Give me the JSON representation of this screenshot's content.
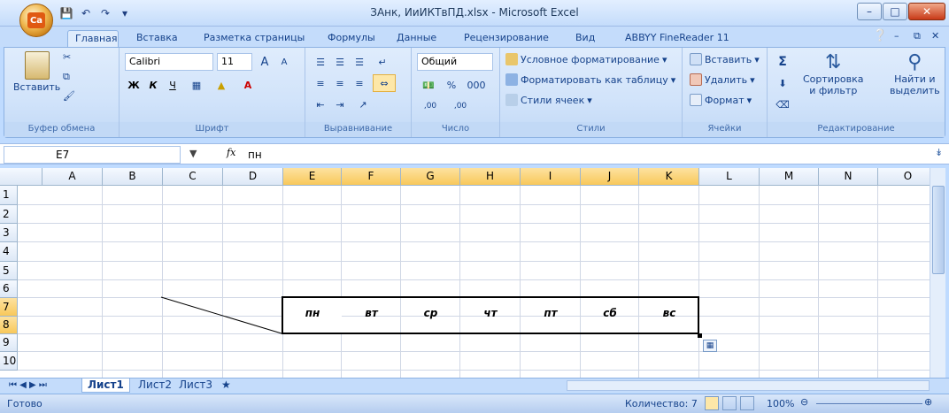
{
  "window": {
    "title": "ЗАнк, ИиИКТвПД.xlsx - Microsoft Excel",
    "minimize_glyph": "–",
    "maximize_glyph": "□",
    "close_glyph": "✕"
  },
  "office_button": {
    "label": "Ca"
  },
  "tabs": [
    {
      "label": "Главная"
    },
    {
      "label": "Вставка"
    },
    {
      "label": "Разметка страницы"
    },
    {
      "label": "Формулы"
    },
    {
      "label": "Данные"
    },
    {
      "label": "Рецензирование"
    },
    {
      "label": "Вид"
    },
    {
      "label": "ABBYY FineReader 11"
    }
  ],
  "ribbon": {
    "clipboard": {
      "paste": "Вставить",
      "label": "Буфер обмена"
    },
    "font": {
      "name": "Calibri",
      "size": "11",
      "label": "Шрифт",
      "bold": "Ж",
      "italic": "К",
      "underline": "Ч",
      "grow": "A",
      "shrink": "A"
    },
    "alignment": {
      "label": "Выравнивание"
    },
    "number": {
      "format": "Общий",
      "percent": "%",
      "thousands": "000",
      "label": "Число",
      "inc": ",00",
      "dec": ",00"
    },
    "styles": {
      "conditional": "Условное форматирование",
      "as_table": "Форматировать как таблицу",
      "cell_styles": "Стили ячеек",
      "label": "Стили"
    },
    "cells": {
      "insert": "Вставить",
      "delete": "Удалить",
      "format": "Формат",
      "label": "Ячейки"
    },
    "editing": {
      "sum": "Σ",
      "sort": "Сортировка",
      "sort2": "и фильтр",
      "find": "Найти и",
      "find2": "выделить",
      "label": "Редактирование"
    }
  },
  "formula_bar": {
    "cell_ref": "E7",
    "fx": "fx",
    "value": "пн"
  },
  "columns": [
    "A",
    "B",
    "C",
    "D",
    "E",
    "F",
    "G",
    "H",
    "I",
    "J",
    "K",
    "L",
    "M",
    "N",
    "O"
  ],
  "rows": [
    "1",
    "2",
    "3",
    "4",
    "5",
    "6",
    "7",
    "8",
    "9",
    "10"
  ],
  "days": [
    "пн",
    "вт",
    "ср",
    "чт",
    "пт",
    "сб",
    "вс"
  ],
  "sheets": [
    "Лист1",
    "Лист2",
    "Лист3"
  ],
  "status": {
    "ready": "Готово",
    "count": "Количество: 7",
    "zoom": "100%"
  }
}
